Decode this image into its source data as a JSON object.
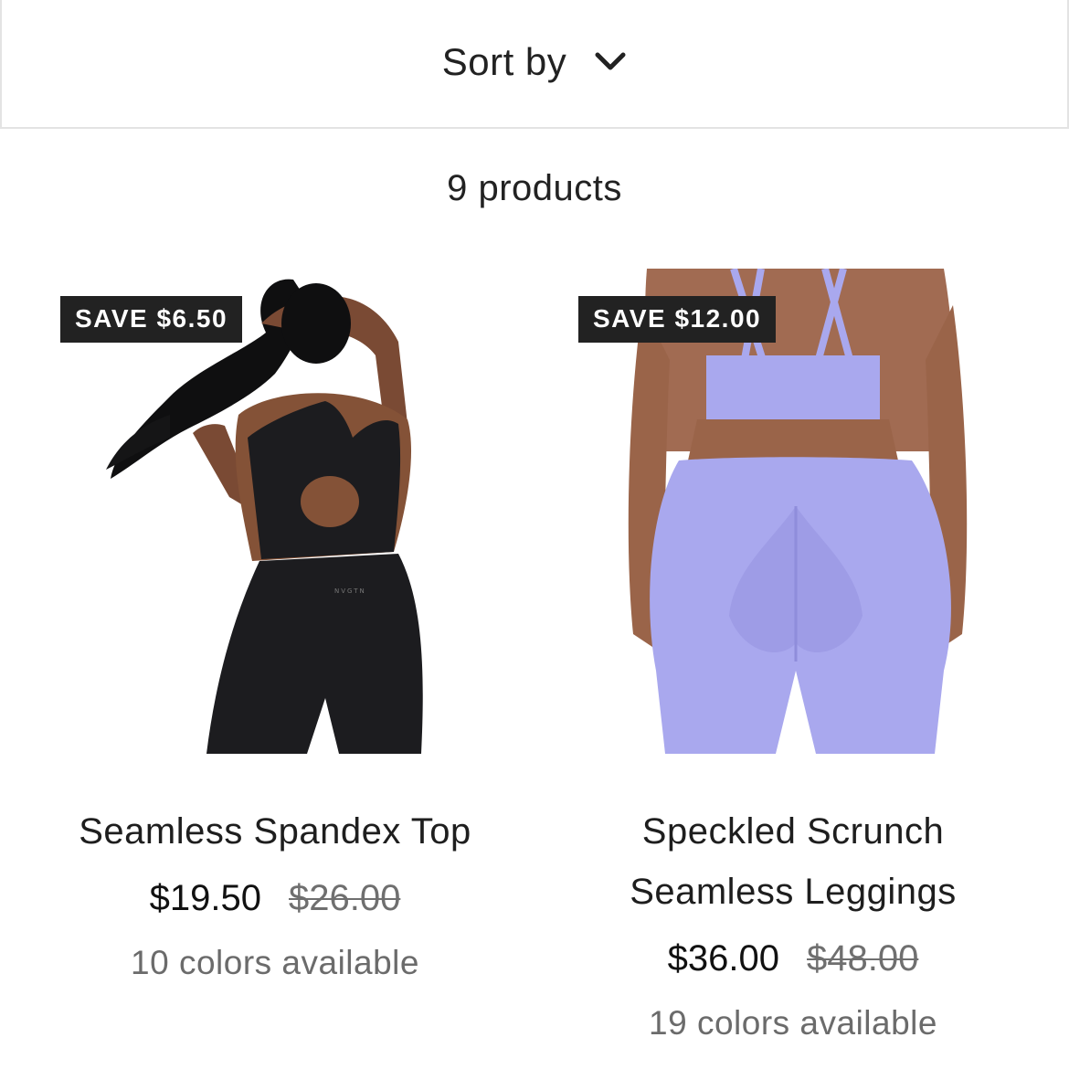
{
  "sort": {
    "label": "Sort by",
    "icon": "chevron-down-icon"
  },
  "product_count": "9 products",
  "products": [
    {
      "badge": "SAVE $6.50",
      "title": "Seamless Spandex Top",
      "price": "$19.50",
      "compare_price": "$26.00",
      "colors": "10 colors available",
      "image_tone": "#1c1c1f"
    },
    {
      "badge": "SAVE $12.00",
      "title": "Speckled Scrunch Seamless Leggings",
      "price": "$36.00",
      "compare_price": "$48.00",
      "colors": "19 colors available",
      "image_tone": "#a9a8ee"
    }
  ],
  "colors": {
    "badge_bg": "#222222",
    "badge_text": "#ffffff",
    "muted_text": "#6b6b6b",
    "border": "#e3e3e3"
  }
}
